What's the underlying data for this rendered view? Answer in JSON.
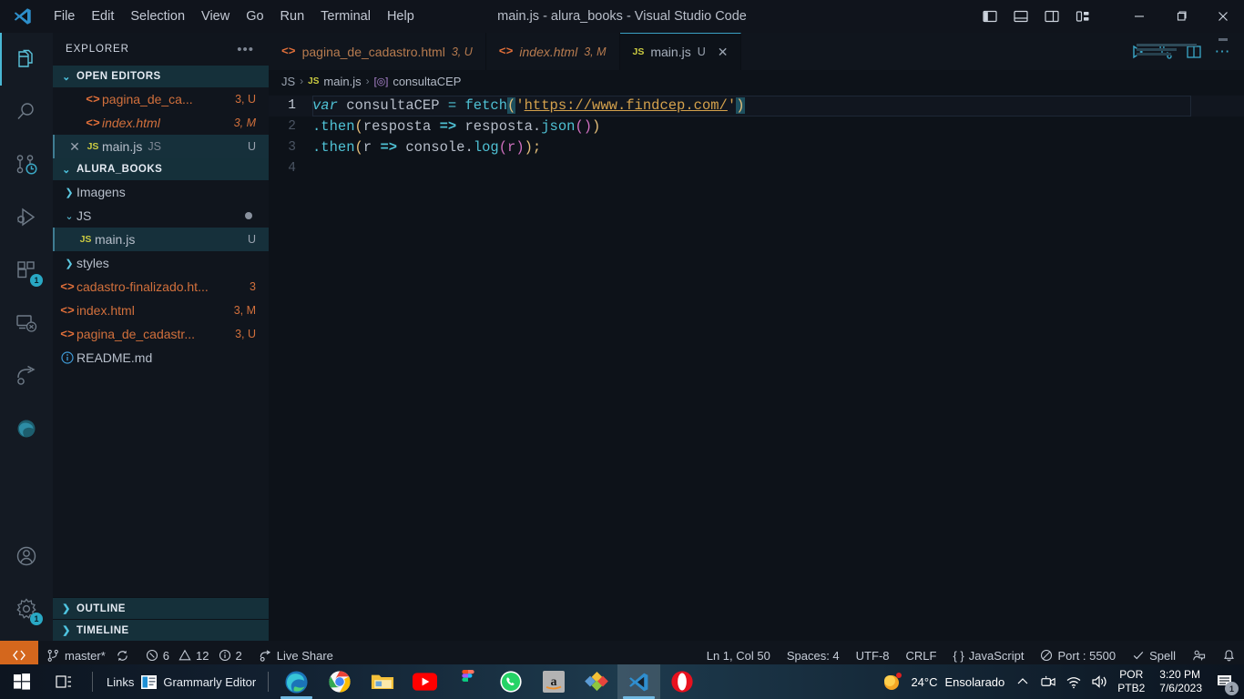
{
  "window": {
    "title": "main.js - alura_books - Visual Studio Code",
    "minimize": "–",
    "maximize": "❐",
    "close": "✕"
  },
  "menu": {
    "items": [
      "File",
      "Edit",
      "Selection",
      "View",
      "Go",
      "Run",
      "Terminal",
      "Help"
    ]
  },
  "layout_buttons": [
    {
      "name": "toggle-primary-sidebar",
      "label": "▐"
    },
    {
      "name": "toggle-panel",
      "label": "▁"
    },
    {
      "name": "toggle-secondary-sidebar",
      "label": "▌"
    },
    {
      "name": "customize-layout",
      "label": "▤"
    }
  ],
  "activitybar": {
    "items": [
      {
        "name": "explorer",
        "icon": "files-icon",
        "badge": ""
      },
      {
        "name": "search",
        "icon": "search-icon",
        "badge": ""
      },
      {
        "name": "source-control",
        "icon": "source-control-icon",
        "badge": ""
      },
      {
        "name": "run-and-debug",
        "icon": "run-debug-icon",
        "badge": ""
      },
      {
        "name": "extensions",
        "icon": "extensions-icon",
        "badge": "1"
      },
      {
        "name": "remote-explorer",
        "icon": "remote-explorer-icon",
        "badge": ""
      },
      {
        "name": "live-share",
        "icon": "live-share-icon",
        "badge": ""
      },
      {
        "name": "browser-preview",
        "icon": "edge-browser-icon",
        "badge": ""
      }
    ],
    "bottom": [
      {
        "name": "accounts",
        "icon": "account-icon",
        "badge": ""
      },
      {
        "name": "manage-settings",
        "icon": "gear-icon",
        "badge": "1"
      }
    ]
  },
  "sidebar": {
    "title": "EXPLORER",
    "more_label": "•••",
    "open_editors": {
      "label": "OPEN EDITORS",
      "items": [
        {
          "icon": "html-icon",
          "name": "pagina_de_ca...",
          "meta": "3, U",
          "italic": false,
          "selected": false,
          "show_close": false
        },
        {
          "icon": "html-icon",
          "name": "index.html",
          "meta": "3, M",
          "italic": true,
          "selected": false,
          "show_close": false
        },
        {
          "icon": "js-icon",
          "name": "main.js",
          "suffix": "JS",
          "meta": "U",
          "italic": false,
          "selected": true,
          "show_close": true
        }
      ]
    },
    "project": {
      "label": "ALURA_BOOKS",
      "items": [
        {
          "kind": "folder",
          "name": "Imagens",
          "expanded": false,
          "meta": "",
          "indent": 1
        },
        {
          "kind": "folder",
          "name": "JS",
          "expanded": true,
          "meta": "",
          "dot": true,
          "indent": 1
        },
        {
          "kind": "js",
          "name": "main.js",
          "meta": "U",
          "indent": 2,
          "selected": true
        },
        {
          "kind": "folder",
          "name": "styles",
          "expanded": false,
          "meta": "",
          "indent": 1
        },
        {
          "kind": "html",
          "name": "cadastro-finalizado.ht...",
          "meta": "3",
          "indent": 1
        },
        {
          "kind": "html",
          "name": "index.html",
          "meta": "3, M",
          "indent": 1
        },
        {
          "kind": "html",
          "name": "pagina_de_cadastr...",
          "meta": "3, U",
          "indent": 1
        },
        {
          "kind": "md",
          "name": "README.md",
          "meta": "",
          "indent": 1
        }
      ]
    },
    "outline": "OUTLINE",
    "timeline": "TIMELINE"
  },
  "tabs": [
    {
      "icon": "html-icon",
      "label": "pagina_de_cadastro.html",
      "meta": "3, U",
      "active": false,
      "italic": false
    },
    {
      "icon": "html-icon",
      "label": "index.html",
      "meta": "3, M",
      "active": false,
      "italic": true
    },
    {
      "icon": "js-icon",
      "label": "main.js",
      "meta": "U",
      "active": true,
      "italic": false,
      "closeable": true
    }
  ],
  "tab_actions": [
    {
      "name": "run-code-button",
      "glyph": "▷"
    },
    {
      "name": "split-source-control-button",
      "glyph": "⑂"
    },
    {
      "name": "split-editor-button",
      "glyph": "▯▯"
    },
    {
      "name": "more-actions-button",
      "glyph": "⋯"
    }
  ],
  "breadcrumb": {
    "folder": "JS",
    "file": "main.js",
    "symbol": "consultaCEP",
    "sep": "›"
  },
  "code": {
    "lines": [
      {
        "num": "1",
        "current": true
      },
      {
        "num": "2",
        "current": false
      },
      {
        "num": "3",
        "current": false
      },
      {
        "num": "4",
        "current": false
      }
    ],
    "line1": {
      "kw": "var",
      "ident": "consultaCEP",
      "eq": "=",
      "fn": "fetch",
      "open_paren": "(",
      "quote": "'",
      "url": "https://www.findcep.com/",
      "close_paren": ")"
    },
    "line2": {
      "dot_then": ".then",
      "open": "(",
      "param": "resposta",
      "arrow": "=>",
      "obj": "resposta",
      "dot": ".",
      "method": "json",
      "parens": "()",
      "close": ")"
    },
    "line3": {
      "dot_then": ".then",
      "open": "(",
      "param": "r",
      "arrow": "=>",
      "obj": "console",
      "dot": ".",
      "method": "log",
      "inner": "(r)",
      "close": ");"
    }
  },
  "statusbar": {
    "remote_icon": "remote-window-icon",
    "branch": "master*",
    "sync_icon": "sync-icon",
    "errors": "6",
    "warnings": "12",
    "infos": "2",
    "live_share": "Live Share",
    "cursor": "Ln 1, Col 50",
    "spaces": "Spaces: 4",
    "encoding": "UTF-8",
    "eol": "CRLF",
    "language": "JavaScript",
    "port": "Port : 5500",
    "spell": "Spell",
    "feedback_icon": "feedback-icon",
    "bell_icon": "bell-icon"
  },
  "taskbar": {
    "start_label": "start-icon",
    "task_view_label": "task-view-icon",
    "links_label": "Links",
    "grammarly_label": "Grammarly Editor",
    "apps": [
      {
        "name": "microsoft-edge",
        "running": true,
        "active": false
      },
      {
        "name": "google-chrome",
        "running": false,
        "active": false
      },
      {
        "name": "file-explorer",
        "running": false,
        "active": false
      },
      {
        "name": "youtube",
        "running": false,
        "active": false
      },
      {
        "name": "figma",
        "running": false,
        "active": false
      },
      {
        "name": "whatsapp",
        "running": false,
        "active": false
      },
      {
        "name": "amazon",
        "running": false,
        "active": false
      },
      {
        "name": "app-colored",
        "running": false,
        "active": false
      },
      {
        "name": "visual-studio-code",
        "running": true,
        "active": true
      },
      {
        "name": "opera",
        "running": false,
        "active": false
      }
    ],
    "weather": {
      "temp": "24°C",
      "condition": "Ensolarado"
    },
    "tray": [
      "show-hidden-icons",
      "camera-icon",
      "wifi-icon",
      "volume-icon"
    ],
    "language": {
      "line1": "POR",
      "line2": "PTB2"
    },
    "clock": {
      "time": "3:20 PM",
      "date": "7/6/2023"
    },
    "notifications": "1"
  },
  "colors": {
    "accent": "#49b7d4",
    "orange": "#d2703c",
    "yellow": "#cbcb41",
    "remote_bg": "#d4671d"
  }
}
